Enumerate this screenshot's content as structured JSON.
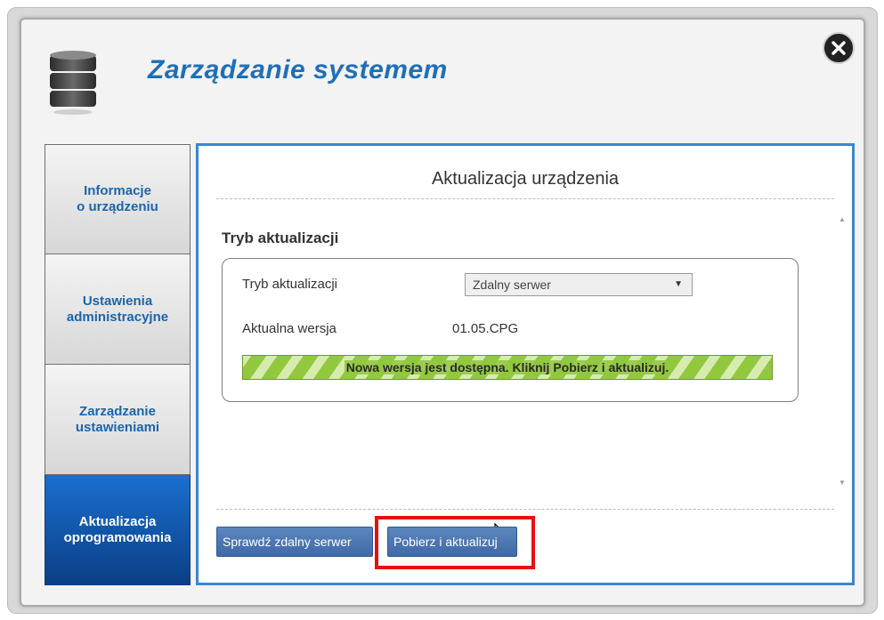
{
  "header": {
    "title": "Zarządzanie systemem"
  },
  "sidebar": {
    "items": [
      {
        "label": "Informacje\no urządzeniu",
        "active": false
      },
      {
        "label": "Ustawienia\nadministracyjne",
        "active": false
      },
      {
        "label": "Zarządzanie\nustawieniami",
        "active": false
      },
      {
        "label": "Aktualizacja\noprogramowania",
        "active": true
      }
    ]
  },
  "panel": {
    "title": "Aktualizacja urządzenia",
    "section_heading": "Tryb aktualizacji",
    "mode_label": "Tryb aktualizacji",
    "mode_value": "Zdalny serwer",
    "version_label": "Aktualna wersja",
    "version_value": "01.05.CPG",
    "status_message": "Nowa wersja jest dostępna. Kliknij Pobierz i aktualizuj."
  },
  "buttons": {
    "check_label": "Sprawdź zdalny serwer",
    "download_label": "Pobierz i aktualizuj"
  },
  "colors": {
    "title": "#1f6fb8",
    "active_tab": "#0b3f86",
    "panel_border": "#3a86d3",
    "status_green": "#92c83e",
    "highlight": "#e81010"
  }
}
